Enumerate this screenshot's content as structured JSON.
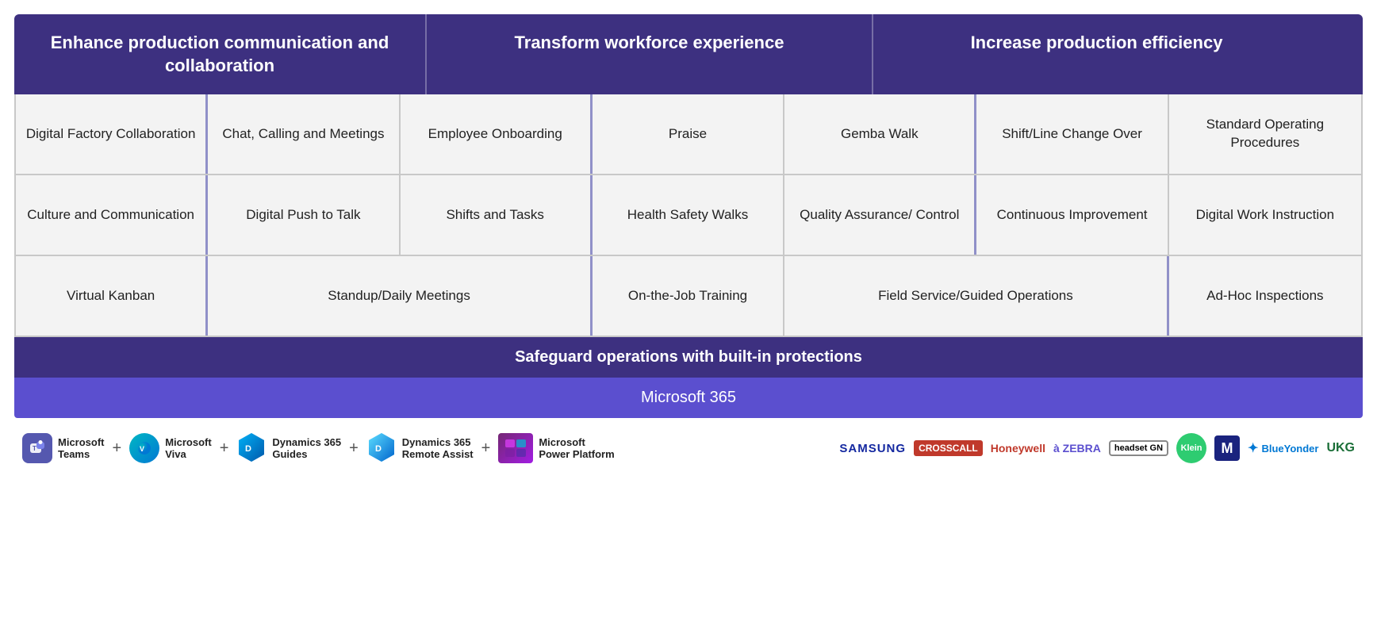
{
  "header": {
    "col1": "Enhance production communication and collaboration",
    "col2": "Transform workforce experience",
    "col3": "Increase production efficiency"
  },
  "rows": [
    {
      "cells": [
        {
          "text": "Digital Factory Collaboration",
          "span": 1
        },
        {
          "text": "Chat, Calling and Meetings",
          "span": 1
        },
        {
          "text": "Employee Onboarding",
          "span": 1,
          "groupEnd": true
        },
        {
          "text": "Praise",
          "span": 1
        },
        {
          "text": "Gemba Walk",
          "span": 1,
          "groupEnd": true
        },
        {
          "text": "Shift/Line Change Over",
          "span": 1
        },
        {
          "text": "Standard Operating Procedures",
          "span": 1
        }
      ]
    },
    {
      "cells": [
        {
          "text": "Culture and Communication",
          "span": 1
        },
        {
          "text": "Digital Push to Talk",
          "span": 1
        },
        {
          "text": "Shifts and Tasks",
          "span": 1,
          "groupEnd": true
        },
        {
          "text": "Health Safety Walks",
          "span": 1
        },
        {
          "text": "Quality Assurance/ Control",
          "span": 1,
          "groupEnd": true
        },
        {
          "text": "Continuous Improvement",
          "span": 1
        },
        {
          "text": "Digital Work Instruction",
          "span": 1
        }
      ]
    },
    {
      "cells": [
        {
          "text": "Virtual Kanban",
          "span": 1
        },
        {
          "text": "Standup/Daily Meetings",
          "span": 2,
          "groupEnd": true
        },
        {
          "text": "On-the-Job Training",
          "span": 1
        },
        {
          "text": "Field Service/Guided Operations",
          "span": 2,
          "groupEnd": true
        },
        {
          "text": "Ad-Hoc Inspections",
          "span": 1
        }
      ]
    }
  ],
  "banners": {
    "safeguard": "Safeguard operations with built-in protections",
    "m365": "Microsoft 365"
  },
  "logos": {
    "items": [
      {
        "name": "Microsoft Teams",
        "icon": "teams"
      },
      {
        "name": "Microsoft Viva",
        "icon": "viva"
      },
      {
        "name": "Dynamics 365 Guides",
        "icon": "guides"
      },
      {
        "name": "Dynamics 365 Remote Assist",
        "icon": "remote"
      },
      {
        "name": "Microsoft Power Platform",
        "icon": "power"
      }
    ],
    "partners": [
      "SAMSUNG",
      "CROSSCALL",
      "Honeywell",
      "ZEBRA",
      "headset",
      "Klein",
      "M",
      "BlueYonder",
      "UKG"
    ]
  }
}
